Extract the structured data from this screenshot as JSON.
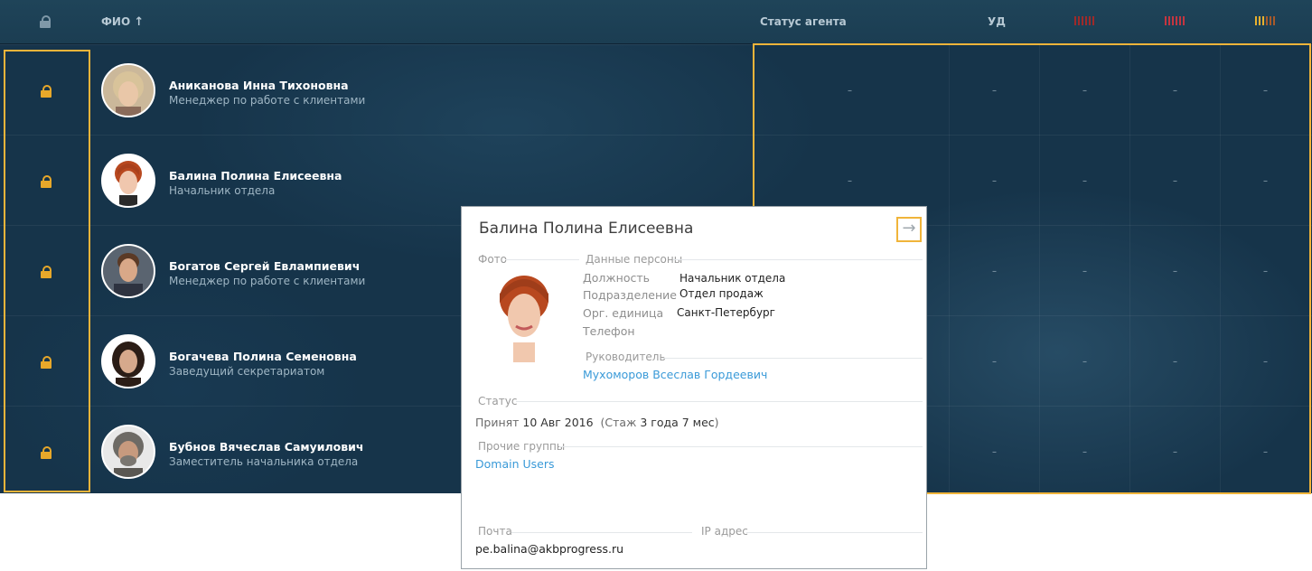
{
  "header": {
    "name_column": "ФИО",
    "sort_icon": "arrow-up-icon",
    "agent_status": "Статус агента",
    "ud": "УД",
    "lock_icon": "lock-icon",
    "indicator_colors": [
      "#a52b2b",
      "#b8323a",
      "#e6b02e"
    ]
  },
  "users": [
    {
      "name": "Аниканова Инна Тихоновна",
      "role": "Менеджер по работе с клиентами",
      "cells": [
        "–",
        "–",
        "–",
        "–",
        "–"
      ]
    },
    {
      "name": "Балина Полина Елисеевна",
      "role": "Начальник отдела",
      "cells": [
        "–",
        "–",
        "–",
        "–",
        "–"
      ]
    },
    {
      "name": "Богатов Сергей Евлампиевич",
      "role": "Менеджер по работе с клиентами",
      "cells": [
        "–",
        "–",
        "–",
        "–",
        "–"
      ]
    },
    {
      "name": "Богачева Полина Семеновна",
      "role": "Заведущий секретариатом",
      "cells": [
        "–",
        "–",
        "–",
        "–",
        "–"
      ]
    },
    {
      "name": "Бубнов Вячеслав Самуилович",
      "role": "Заместитель начальника отдела",
      "cells": [
        "–",
        "–",
        "–",
        "–",
        "–"
      ]
    }
  ],
  "card": {
    "title": "Балина Полина Елисеевна",
    "photo_label": "Фото",
    "person_section": "Данные персоны",
    "fields": [
      {
        "label": "Должность",
        "value": "Начальник отдела"
      },
      {
        "label": "Подразделение",
        "value": "Отдел продаж"
      },
      {
        "label": "Орг. единица",
        "value": "Санкт-Петербург"
      },
      {
        "label": "Телефон",
        "value": ""
      }
    ],
    "manager_section": "Руководитель",
    "manager": "Мухоморов Всеслав Гордеевич",
    "status_section": "Статус",
    "status_prefix": "Принят",
    "hire_date": "10 Авг 2016",
    "tenure_open": "(Стаж",
    "tenure": "3 года 7 мес",
    "tenure_close": ")",
    "groups_section": "Прочие группы",
    "group": "Domain Users",
    "email_section": "Почта",
    "ip_section": "IP адрес",
    "email": "pe.balina@akbprogress.ru",
    "go_icon": "arrow-right-icon",
    "highlight_color": "#f0b43a",
    "link_color": "#3a9ad8"
  }
}
